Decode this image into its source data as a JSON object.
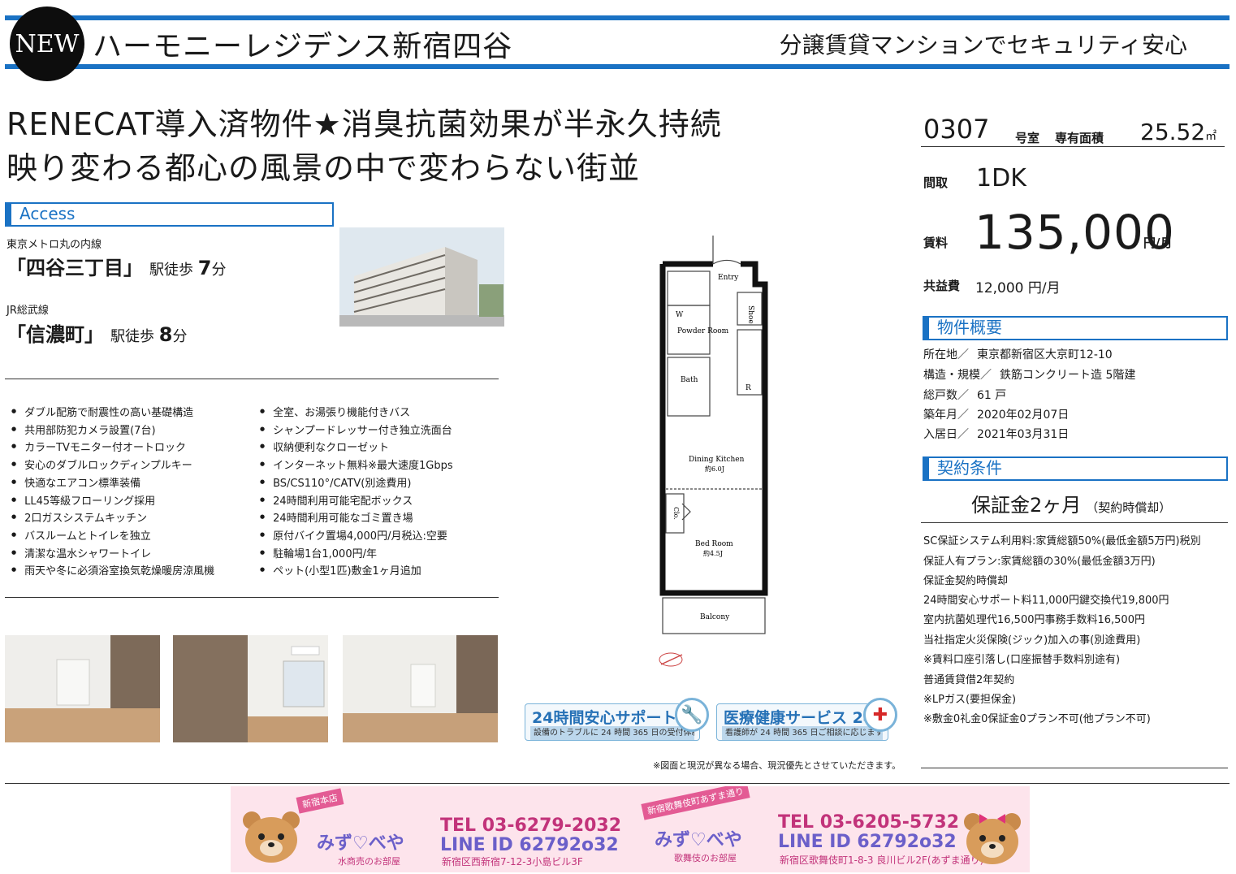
{
  "header": {
    "badge": "NEW",
    "property_name": "ハーモニーレジデンス新宿四谷",
    "tagline": "分譲賃貸マンションでセキュリティ安心"
  },
  "headlines": [
    "RENECAT導入済物件★消臭抗菌効果が半永久持続",
    "映り変わる都心の風景の中で変わらない街並"
  ],
  "access": {
    "label": "Access",
    "routes": [
      {
        "line": "東京メトロ丸の内線",
        "station": "「四谷三丁目」",
        "walk_prefix": "駅徒歩",
        "minutes": "7",
        "unit": "分"
      },
      {
        "line": "JR総武線",
        "station": "「信濃町」",
        "walk_prefix": "駅徒歩",
        "minutes": "8",
        "unit": "分"
      }
    ]
  },
  "features_left": [
    "ダブル配筋で耐震性の高い基礎構造",
    "共用部防犯カメラ設置(7台)",
    "カラーTVモニター付オートロック",
    "安心のダブルロックディンプルキー",
    "快適なエアコン標準装備",
    "LL45等級フローリング採用",
    "2口ガスシステムキッチン",
    "バスルームとトイレを独立",
    "清潔な温水シャワートイレ",
    "雨天や冬に必須浴室換気乾燥暖房涼風機"
  ],
  "features_right": [
    "全室、お湯張り機能付きバス",
    "シャンプードレッサー付き独立洗面台",
    "収納便利なクローゼット",
    "インターネット無料※最大速度1Gbps",
    "BS/CS110°/CATV(別途費用)",
    "24時間利用可能宅配ボックス",
    "24時間利用可能なゴミ置き場",
    "原付バイク置場4,000円/月税込:空要",
    "駐輪場1台1,000円/年",
    "ペット(小型1匹)敷金1ヶ月追加"
  ],
  "floorplan": {
    "labels": [
      "Entry",
      "Shoe",
      "W",
      "Powder Room",
      "Bath",
      "R",
      "Dining Kitchen",
      "約6.0J",
      "Clo.",
      "Bed Room",
      "約4.5J",
      "Balcony"
    ]
  },
  "room": {
    "number": "0307",
    "room_label": "号室",
    "area_label": "専有面積",
    "area_value": "25.52",
    "area_unit": "㎡",
    "layout_label": "間取",
    "layout_value": "1DK",
    "rent_label": "賃料",
    "rent_value": "135,000",
    "rent_unit": "円/月",
    "fee_label": "共益費",
    "fee_value": "12,000 円/月"
  },
  "overview": {
    "label": "物件概要",
    "rows": [
      {
        "k": "所在地／",
        "v": "東京都新宿区大京町12-10"
      },
      {
        "k": "構造・規模／",
        "v": "鉄筋コンクリート造  5階建"
      },
      {
        "k": "総戸数／",
        "v": "61     戸"
      },
      {
        "k": "築年月／",
        "v": "2020年02月07日"
      },
      {
        "k": "入居日／",
        "v": "2021年03月31日"
      }
    ]
  },
  "contract": {
    "label": "契約条件",
    "deposit": "保証金2ヶ月",
    "deposit_note": "（契約時償却）",
    "conditions": [
      "SC保証システム利用料:家賃総額50%(最低金額5万円)税別",
      "保証人有プラン:家賃総額の30%(最低金額3万円)",
      "保証金契約時償却",
      "24時間安心サポート料11,000円鍵交換代19,800円",
      "室内抗菌処理代16,500円事務手数料16,500円",
      "当社指定火災保険(ジック)加入の事(別途費用)",
      "※賃料口座引落し(口座振替手数料別途有)",
      "普通賃貸借2年契約",
      "※LPガス(要担保金)",
      "※敷金0礼金0保証金0プラン不可(他プラン不可)"
    ]
  },
  "badges": [
    {
      "title": "24時間安心サポート",
      "sub": "設備のトラブルに 24 時間 365 日の受付体制",
      "icon": "wrench-icon"
    },
    {
      "title": "医療健康サービス 24",
      "sub": "看護師が 24 時間 365 日ご相談に応じます。",
      "icon": "red-cross-icon"
    }
  ],
  "disclaimer": "※図面と現況が異なる場合、現況優先とさせていただきます。",
  "banner": {
    "stores": [
      {
        "ribbon": "新宿本店",
        "name": "みず♡べや",
        "sub": "水商売のお部屋",
        "tel": "TEL 03-6279-2032",
        "line": "LINE ID 62792o32",
        "address": "新宿区西新宿7-12-3小島ビル3F"
      },
      {
        "ribbon": "新宿歌舞伎町あずま通り",
        "name": "みず♡べや",
        "sub": "歌舞伎のお部屋",
        "tel": "TEL 03-6205-5732",
        "line": "LINE ID 62792o32",
        "address": "新宿区歌舞伎町1-8-3 良川ビル2F(あずま通り)"
      }
    ]
  }
}
